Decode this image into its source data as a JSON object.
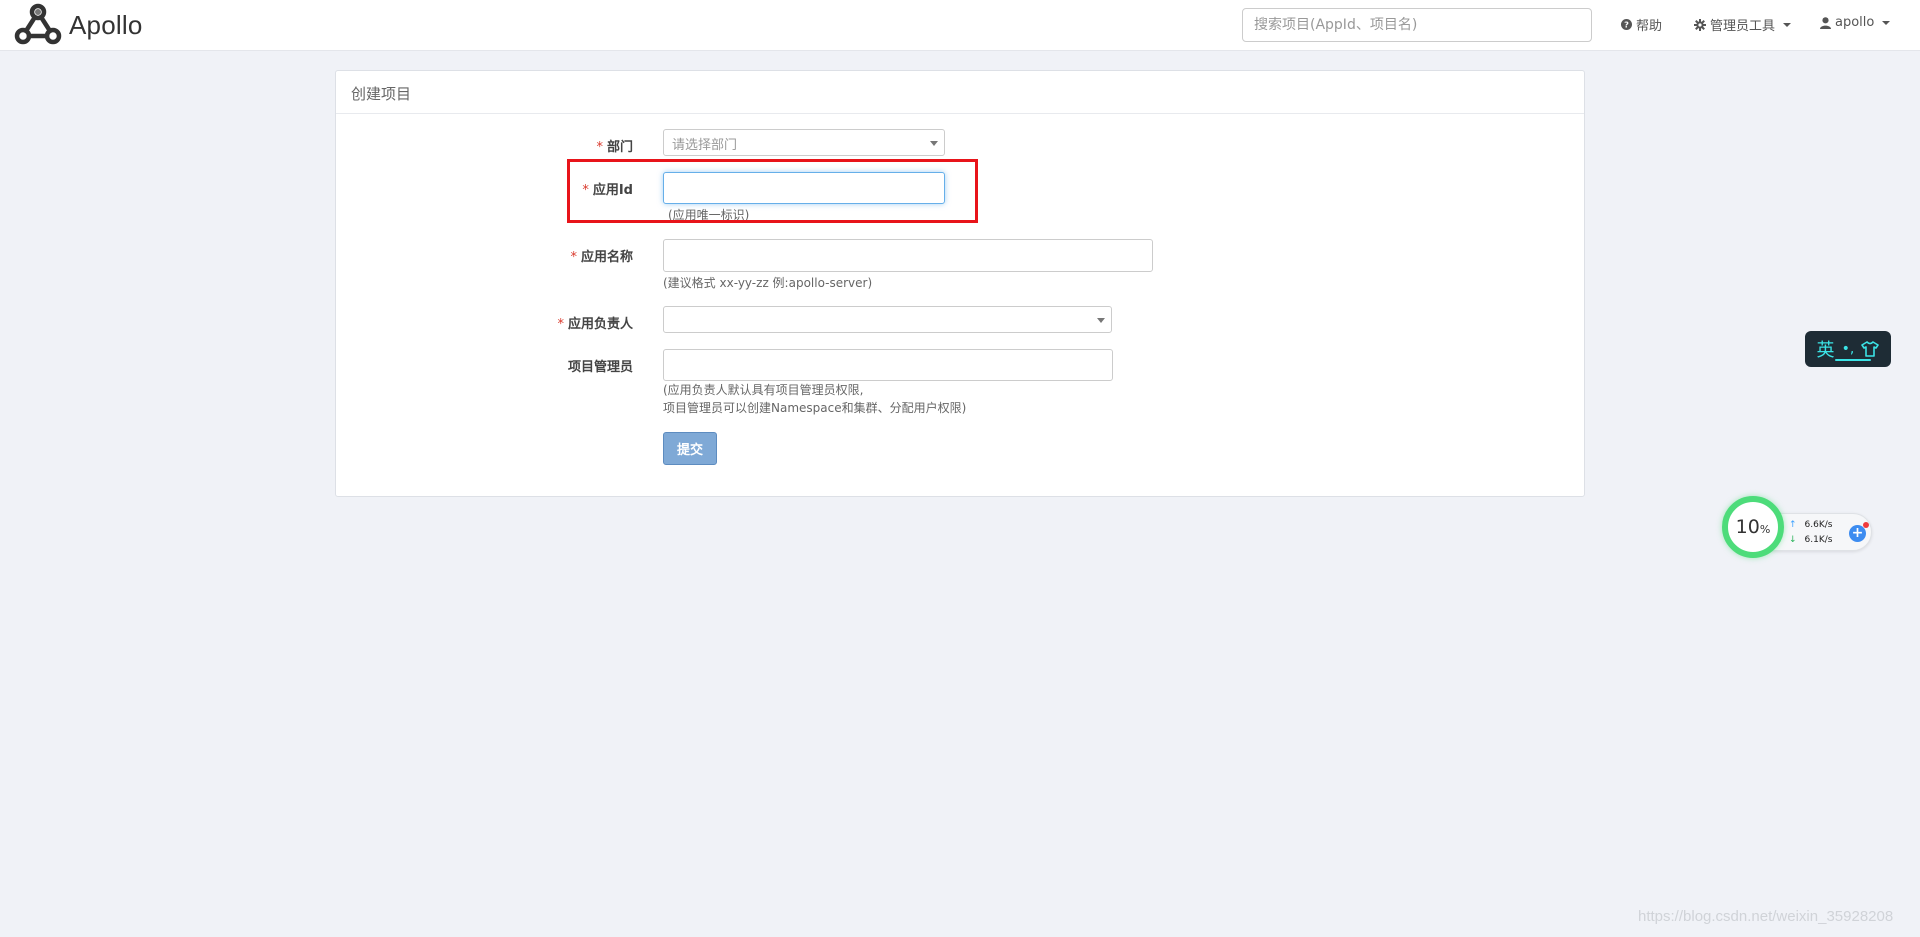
{
  "navbar": {
    "logo_text": "Apollo",
    "search_placeholder": "搜索项目(AppId、项目名)",
    "help_label": "帮助",
    "admin_tools_label": "管理员工具",
    "user_label": "apollo"
  },
  "panel": {
    "title": "创建项目",
    "fields": {
      "department": {
        "label": "部门",
        "placeholder": "请选择部门"
      },
      "app_id": {
        "label": "应用Id",
        "value": "",
        "help": "(应用唯一标识)"
      },
      "app_name": {
        "label": "应用名称",
        "value": "",
        "help": "(建议格式 xx-yy-zz 例:apollo-server)"
      },
      "owner": {
        "label": "应用负责人",
        "value": ""
      },
      "admins": {
        "label": "项目管理员",
        "value": "",
        "help_line1": "(应用负责人默认具有项目管理员权限,",
        "help_line2": "项目管理员可以创建Namespace和集群、分配用户权限)"
      }
    },
    "submit_label": "提交"
  },
  "ime_widget": {
    "mode_label": "英",
    "punct_label": "•,",
    "skin_icon": "shirt-icon"
  },
  "network_widget": {
    "cpu_value": "10",
    "cpu_unit": "%",
    "upload": "6.6K/s",
    "download": "6.1K/s"
  },
  "watermark": "https://blog.csdn.net/weixin_35928208",
  "colors": {
    "required": "#d9382b",
    "submit": "#7fa9d6",
    "highlight": "#e8141a",
    "focus": "#66afe9"
  }
}
